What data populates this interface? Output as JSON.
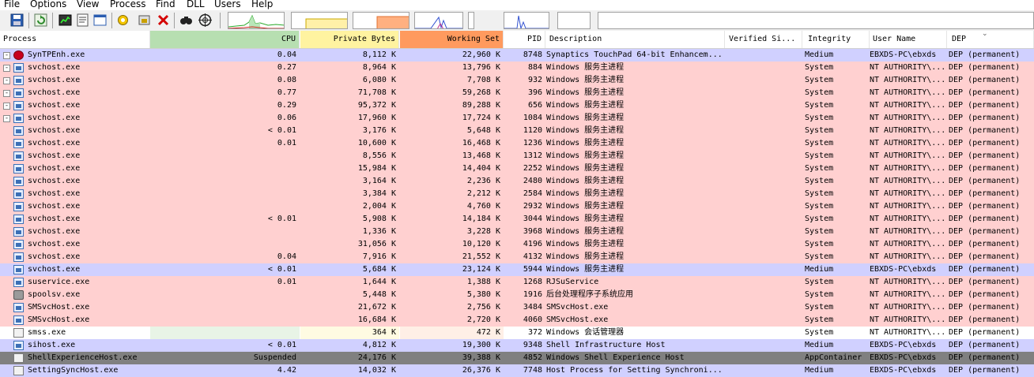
{
  "menu": [
    "File",
    "Options",
    "View",
    "Process",
    "Find",
    "DLL",
    "Users",
    "Help"
  ],
  "toolbar": {
    "icons": [
      "save-icon",
      "refresh-icon",
      "system-info-icon",
      "properties-icon",
      "window-icon",
      "options-icon",
      "target-icon",
      "kill-process-icon",
      "find-icon",
      "crosshair-icon"
    ],
    "graphs": [
      "cpu-graph",
      "commit-graph",
      "physical-memory-graph",
      "io-graph",
      "network-graph",
      "disk-graph"
    ]
  },
  "colors": {
    "service": "#ffd0d0",
    "own_process": "#d0d0ff",
    "suspended": "#808080",
    "normal": "#ffffff",
    "cpu_header": "#b7dfb1",
    "private_bytes_header": "#fff3a0",
    "working_set_header": "#ff9a5e",
    "cpu_column": "#e8f4e6",
    "private_column": "#fffbe2",
    "ws_column": "#ffefe6"
  },
  "columns": {
    "process": "Process",
    "cpu": "CPU",
    "private_bytes": "Private Bytes",
    "working_set": "Working Set",
    "pid": "PID",
    "description": "Description",
    "verified_signer": "Verified Si...",
    "integrity": "Integrity",
    "user_name": "User Name",
    "dep": "DEP"
  },
  "rows": [
    {
      "tree": "-",
      "icon": "syn",
      "name": "SynTPEnh.exe",
      "cpu": "0.04",
      "private": "8,112 K",
      "ws": "22,960 K",
      "pid": "8748",
      "desc": "Synaptics TouchPad 64-bit Enhancem...",
      "ver": "",
      "integrity": "Medium",
      "user": "EBXDS-PC\\ebxds",
      "dep": "DEP (permanent)",
      "kind": "own_process"
    },
    {
      "tree": "-",
      "icon": "svc",
      "name": "svchost.exe",
      "cpu": "0.27",
      "private": "8,964 K",
      "ws": "13,796 K",
      "pid": "884",
      "desc": "Windows 服务主进程",
      "ver": "",
      "integrity": "System",
      "user": "NT AUTHORITY\\...",
      "dep": "DEP (permanent)",
      "kind": "service"
    },
    {
      "tree": "-",
      "icon": "svc",
      "name": "svchost.exe",
      "cpu": "0.08",
      "private": "6,080 K",
      "ws": "7,708 K",
      "pid": "932",
      "desc": "Windows 服务主进程",
      "ver": "",
      "integrity": "System",
      "user": "NT AUTHORITY\\...",
      "dep": "DEP (permanent)",
      "kind": "service"
    },
    {
      "tree": "-",
      "icon": "svc",
      "name": "svchost.exe",
      "cpu": "0.77",
      "private": "71,708 K",
      "ws": "59,268 K",
      "pid": "396",
      "desc": "Windows 服务主进程",
      "ver": "",
      "integrity": "System",
      "user": "NT AUTHORITY\\...",
      "dep": "DEP (permanent)",
      "kind": "service"
    },
    {
      "tree": "-",
      "icon": "svc",
      "name": "svchost.exe",
      "cpu": "0.29",
      "private": "95,372 K",
      "ws": "89,288 K",
      "pid": "656",
      "desc": "Windows 服务主进程",
      "ver": "",
      "integrity": "System",
      "user": "NT AUTHORITY\\...",
      "dep": "DEP (permanent)",
      "kind": "service"
    },
    {
      "tree": "-",
      "icon": "svc",
      "name": "svchost.exe",
      "cpu": "0.06",
      "private": "17,960 K",
      "ws": "17,724 K",
      "pid": "1084",
      "desc": "Windows 服务主进程",
      "ver": "",
      "integrity": "System",
      "user": "NT AUTHORITY\\...",
      "dep": "DEP (permanent)",
      "kind": "service"
    },
    {
      "tree": "",
      "icon": "svc",
      "name": "svchost.exe",
      "cpu": "< 0.01",
      "private": "3,176 K",
      "ws": "5,648 K",
      "pid": "1120",
      "desc": "Windows 服务主进程",
      "ver": "",
      "integrity": "System",
      "user": "NT AUTHORITY\\...",
      "dep": "DEP (permanent)",
      "kind": "service"
    },
    {
      "tree": "",
      "icon": "svc",
      "name": "svchost.exe",
      "cpu": "0.01",
      "private": "10,600 K",
      "ws": "16,468 K",
      "pid": "1236",
      "desc": "Windows 服务主进程",
      "ver": "",
      "integrity": "System",
      "user": "NT AUTHORITY\\...",
      "dep": "DEP (permanent)",
      "kind": "service"
    },
    {
      "tree": "",
      "icon": "svc",
      "name": "svchost.exe",
      "cpu": "",
      "private": "8,556 K",
      "ws": "13,468 K",
      "pid": "1312",
      "desc": "Windows 服务主进程",
      "ver": "",
      "integrity": "System",
      "user": "NT AUTHORITY\\...",
      "dep": "DEP (permanent)",
      "kind": "service"
    },
    {
      "tree": "",
      "icon": "svc",
      "name": "svchost.exe",
      "cpu": "",
      "private": "15,984 K",
      "ws": "14,404 K",
      "pid": "2252",
      "desc": "Windows 服务主进程",
      "ver": "",
      "integrity": "System",
      "user": "NT AUTHORITY\\...",
      "dep": "DEP (permanent)",
      "kind": "service"
    },
    {
      "tree": "",
      "icon": "svc",
      "name": "svchost.exe",
      "cpu": "",
      "private": "3,164 K",
      "ws": "2,236 K",
      "pid": "2480",
      "desc": "Windows 服务主进程",
      "ver": "",
      "integrity": "System",
      "user": "NT AUTHORITY\\...",
      "dep": "DEP (permanent)",
      "kind": "service"
    },
    {
      "tree": "",
      "icon": "svc",
      "name": "svchost.exe",
      "cpu": "",
      "private": "3,384 K",
      "ws": "2,212 K",
      "pid": "2584",
      "desc": "Windows 服务主进程",
      "ver": "",
      "integrity": "System",
      "user": "NT AUTHORITY\\...",
      "dep": "DEP (permanent)",
      "kind": "service"
    },
    {
      "tree": "",
      "icon": "svc",
      "name": "svchost.exe",
      "cpu": "",
      "private": "2,004 K",
      "ws": "4,760 K",
      "pid": "2932",
      "desc": "Windows 服务主进程",
      "ver": "",
      "integrity": "System",
      "user": "NT AUTHORITY\\...",
      "dep": "DEP (permanent)",
      "kind": "service"
    },
    {
      "tree": "",
      "icon": "svc",
      "name": "svchost.exe",
      "cpu": "< 0.01",
      "private": "5,908 K",
      "ws": "14,184 K",
      "pid": "3044",
      "desc": "Windows 服务主进程",
      "ver": "",
      "integrity": "System",
      "user": "NT AUTHORITY\\...",
      "dep": "DEP (permanent)",
      "kind": "service"
    },
    {
      "tree": "",
      "icon": "svc",
      "name": "svchost.exe",
      "cpu": "",
      "private": "1,336 K",
      "ws": "3,228 K",
      "pid": "3968",
      "desc": "Windows 服务主进程",
      "ver": "",
      "integrity": "System",
      "user": "NT AUTHORITY\\...",
      "dep": "DEP (permanent)",
      "kind": "service"
    },
    {
      "tree": "",
      "icon": "svc",
      "name": "svchost.exe",
      "cpu": "",
      "private": "31,056 K",
      "ws": "10,120 K",
      "pid": "4196",
      "desc": "Windows 服务主进程",
      "ver": "",
      "integrity": "System",
      "user": "NT AUTHORITY\\...",
      "dep": "DEP (permanent)",
      "kind": "service"
    },
    {
      "tree": "",
      "icon": "svc",
      "name": "svchost.exe",
      "cpu": "0.04",
      "private": "7,916 K",
      "ws": "21,552 K",
      "pid": "4132",
      "desc": "Windows 服务主进程",
      "ver": "",
      "integrity": "System",
      "user": "NT AUTHORITY\\...",
      "dep": "DEP (permanent)",
      "kind": "service"
    },
    {
      "tree": "",
      "icon": "svc",
      "name": "svchost.exe",
      "cpu": "< 0.01",
      "private": "5,684 K",
      "ws": "23,124 K",
      "pid": "5944",
      "desc": "Windows 服务主进程",
      "ver": "",
      "integrity": "Medium",
      "user": "EBXDS-PC\\ebxds",
      "dep": "DEP (permanent)",
      "kind": "own_process"
    },
    {
      "tree": "",
      "icon": "svc",
      "name": "suservice.exe",
      "cpu": "0.01",
      "private": "1,644 K",
      "ws": "1,388 K",
      "pid": "1268",
      "desc": "RJSuService",
      "ver": "",
      "integrity": "System",
      "user": "NT AUTHORITY\\...",
      "dep": "DEP (permanent)",
      "kind": "service"
    },
    {
      "tree": "",
      "icon": "prn",
      "name": "spoolsv.exe",
      "cpu": "",
      "private": "5,448 K",
      "ws": "5,380 K",
      "pid": "1916",
      "desc": "后台处理程序子系统应用",
      "ver": "",
      "integrity": "System",
      "user": "NT AUTHORITY\\...",
      "dep": "DEP (permanent)",
      "kind": "service"
    },
    {
      "tree": "",
      "icon": "svc",
      "name": "SMSvcHost.exe",
      "cpu": "",
      "private": "21,672 K",
      "ws": "2,756 K",
      "pid": "3484",
      "desc": "SMSvcHost.exe",
      "ver": "",
      "integrity": "System",
      "user": "NT AUTHORITY\\...",
      "dep": "DEP (permanent)",
      "kind": "service"
    },
    {
      "tree": "",
      "icon": "svc",
      "name": "SMSvcHost.exe",
      "cpu": "",
      "private": "16,684 K",
      "ws": "2,720 K",
      "pid": "4060",
      "desc": "SMSvcHost.exe",
      "ver": "",
      "integrity": "System",
      "user": "NT AUTHORITY\\...",
      "dep": "DEP (permanent)",
      "kind": "service"
    },
    {
      "tree": "",
      "icon": "gen",
      "name": "smss.exe",
      "cpu": "",
      "private": "364 K",
      "ws": "472 K",
      "pid": "372",
      "desc": "Windows 会话管理器",
      "ver": "",
      "integrity": "System",
      "user": "NT AUTHORITY\\...",
      "dep": "DEP (permanent)",
      "kind": "normal"
    },
    {
      "tree": "",
      "icon": "svc",
      "name": "sihost.exe",
      "cpu": "< 0.01",
      "private": "4,812 K",
      "ws": "19,300 K",
      "pid": "9348",
      "desc": "Shell Infrastructure Host",
      "ver": "",
      "integrity": "Medium",
      "user": "EBXDS-PC\\ebxds",
      "dep": "DEP (permanent)",
      "kind": "own_process"
    },
    {
      "tree": "",
      "icon": "gen",
      "name": "ShellExperienceHost.exe",
      "cpu": "Suspended",
      "private": "24,176 K",
      "ws": "39,388 K",
      "pid": "4852",
      "desc": "Windows Shell Experience Host",
      "ver": "",
      "integrity": "AppContainer",
      "user": "EBXDS-PC\\ebxds",
      "dep": "DEP (permanent)",
      "kind": "suspended"
    },
    {
      "tree": "",
      "icon": "gen",
      "name": "SettingSyncHost.exe",
      "cpu": "4.42",
      "private": "14,032 K",
      "ws": "26,376 K",
      "pid": "7748",
      "desc": "Host Process for Setting Synchroni...",
      "ver": "",
      "integrity": "Medium",
      "user": "EBXDS-PC\\ebxds",
      "dep": "DEP (permanent)",
      "kind": "own_process"
    }
  ]
}
